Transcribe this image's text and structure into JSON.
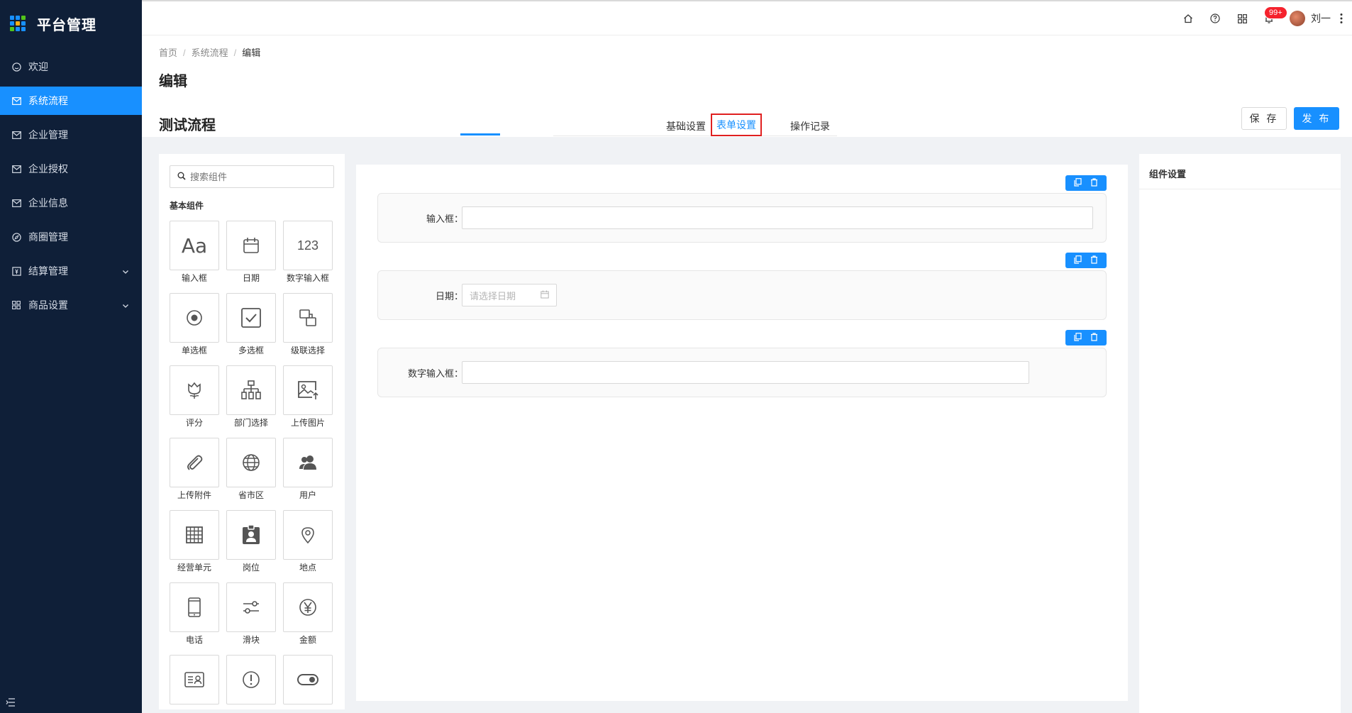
{
  "app": {
    "title": "平台管理"
  },
  "sidebar": {
    "items": [
      {
        "label": "欢迎",
        "icon": "smile-icon"
      },
      {
        "label": "系统流程",
        "icon": "mail-icon",
        "active": true
      },
      {
        "label": "企业管理",
        "icon": "mail-icon"
      },
      {
        "label": "企业授权",
        "icon": "mail-icon"
      },
      {
        "label": "企业信息",
        "icon": "mail-icon"
      },
      {
        "label": "商圈管理",
        "icon": "compass-icon"
      },
      {
        "label": "结算管理",
        "icon": "calculator-icon",
        "expandable": true
      },
      {
        "label": "商品设置",
        "icon": "grid-icon",
        "expandable": true
      }
    ]
  },
  "topbar": {
    "badge": "99+",
    "username": "刘一"
  },
  "breadcrumb": {
    "home": "首页",
    "section": "系统流程",
    "current": "编辑"
  },
  "page": {
    "title": "编辑",
    "flow_name": "测试流程"
  },
  "tabs": {
    "basic": "基础设置",
    "form": "表单设置",
    "log": "操作记录"
  },
  "actions": {
    "save": "保 存",
    "publish": "发 布"
  },
  "components": {
    "search_placeholder": "搜索组件",
    "group_title": "基本组件",
    "items": [
      "输入框",
      "日期",
      "数字输入框",
      "单选框",
      "多选框",
      "级联选择",
      "评分",
      "部门选择",
      "上传图片",
      "上传附件",
      "省市区",
      "用户",
      "经营单元",
      "岗位",
      "地点",
      "电话",
      "滑块",
      "金额"
    ],
    "icon_texts": {
      "input": "Aa",
      "number": "123"
    }
  },
  "form_fields": [
    {
      "label": "输入框："
    },
    {
      "label": "日期：",
      "placeholder": "请选择日期"
    },
    {
      "label": "数字输入框："
    }
  ],
  "settings": {
    "title": "组件设置"
  },
  "colors": {
    "primary": "#1890ff",
    "sidebar_bg": "#0f1f38",
    "highlight": "#e02020"
  }
}
